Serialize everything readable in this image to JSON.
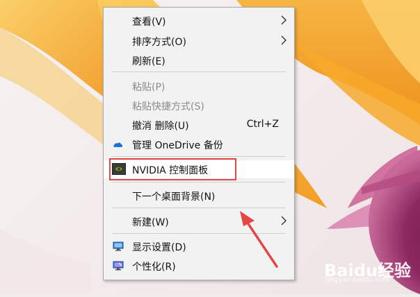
{
  "menu": {
    "items": [
      {
        "label": "查看(V)",
        "submenu": true
      },
      {
        "label": "排序方式(O)",
        "submenu": true
      },
      {
        "label": "刷新(E)"
      },
      {
        "label": "粘贴(P)",
        "disabled": true
      },
      {
        "label": "粘贴快捷方式(S)",
        "disabled": true
      },
      {
        "label": "撤消 删除(U)",
        "shortcut": "Ctrl+Z"
      },
      {
        "label": "管理 OneDrive 备份",
        "icon": "onedrive-cloud-icon"
      },
      {
        "label": "NVIDIA 控制面板",
        "icon": "nvidia-icon"
      },
      {
        "label": "下一个桌面背景(N)"
      },
      {
        "label": "新建(W)",
        "submenu": true
      },
      {
        "label": "显示设置(D)",
        "icon": "display-settings-icon"
      },
      {
        "label": "个性化(R)",
        "icon": "personalize-icon"
      }
    ]
  },
  "colors": {
    "highlight_box": "#e64545",
    "arrow": "#e64545"
  },
  "watermark": {
    "brand": "Baidu经验",
    "url": "jingyan.baidu.com"
  }
}
